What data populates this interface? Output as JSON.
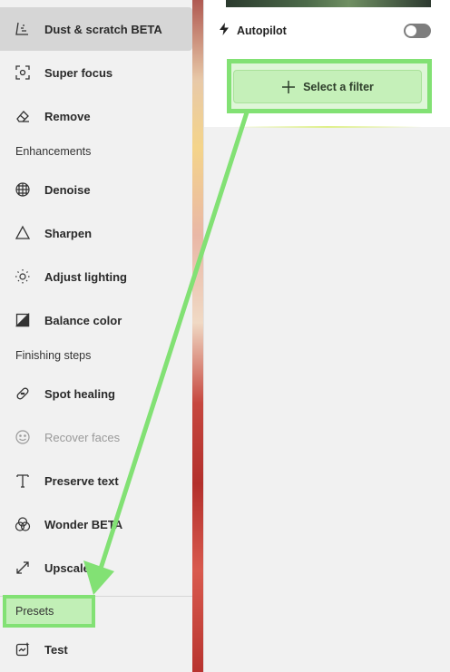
{
  "menu": {
    "items": [
      {
        "label": "Dust & scratch BETA",
        "icon": "dust-scratch-icon",
        "state": "active"
      },
      {
        "label": "Super focus",
        "icon": "super-focus-icon",
        "state": "normal"
      },
      {
        "label": "Remove",
        "icon": "eraser-icon",
        "state": "normal"
      }
    ],
    "enhancements_title": "Enhancements",
    "enhancements": [
      {
        "label": "Denoise",
        "icon": "denoise-icon"
      },
      {
        "label": "Sharpen",
        "icon": "sharpen-icon"
      },
      {
        "label": "Adjust lighting",
        "icon": "lighting-icon"
      },
      {
        "label": "Balance color",
        "icon": "balance-color-icon"
      }
    ],
    "finishing_title": "Finishing steps",
    "finishing": [
      {
        "label": "Spot healing",
        "icon": "spot-healing-icon",
        "state": "normal"
      },
      {
        "label": "Recover faces",
        "icon": "face-icon",
        "state": "disabled"
      },
      {
        "label": "Preserve text",
        "icon": "text-icon",
        "state": "normal"
      },
      {
        "label": "Wonder BETA",
        "icon": "wonder-icon",
        "state": "normal"
      },
      {
        "label": "Upscale",
        "icon": "upscale-icon",
        "state": "normal"
      }
    ],
    "presets_label": "Presets",
    "test_label": "Test"
  },
  "panel": {
    "autopilot_label": "Autopilot",
    "autopilot_on": false,
    "select_filter_label": "Select a filter"
  },
  "colors": {
    "highlight_green": "#82e174",
    "button_green": "#c5f0b9"
  }
}
